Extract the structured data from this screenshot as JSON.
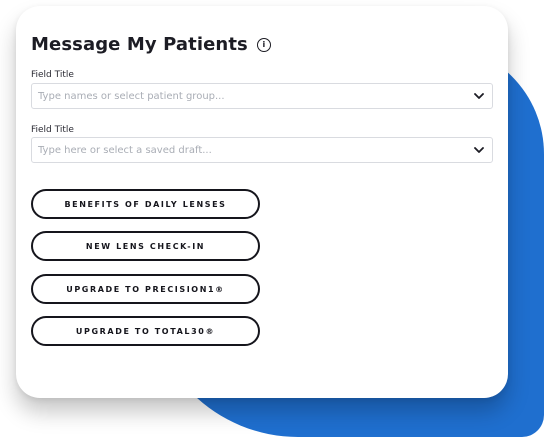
{
  "panel": {
    "title": "Message My Patients",
    "info_glyph": "i",
    "info_icon": "info-icon"
  },
  "fields": [
    {
      "label": "Field Title",
      "placeholder": "Type names or select patient group...",
      "icon": "chevron-down-icon"
    },
    {
      "label": "Field Title",
      "placeholder": "Type here or select a saved draft...",
      "icon": "chevron-down-icon"
    }
  ],
  "templates": [
    {
      "label": "BENEFITS OF DAILY LENSES"
    },
    {
      "label": "NEW LENS CHECK-IN"
    },
    {
      "label": "UPGRADE TO PRECISION1®"
    },
    {
      "label": "UPGRADE TO TOTAL30®"
    }
  ],
  "colors": {
    "backdrop": "#1f6fcf",
    "text": "#1c1c24",
    "placeholder": "#a9adb5",
    "input_border": "#d9dbe0",
    "button_border": "#15151c"
  }
}
